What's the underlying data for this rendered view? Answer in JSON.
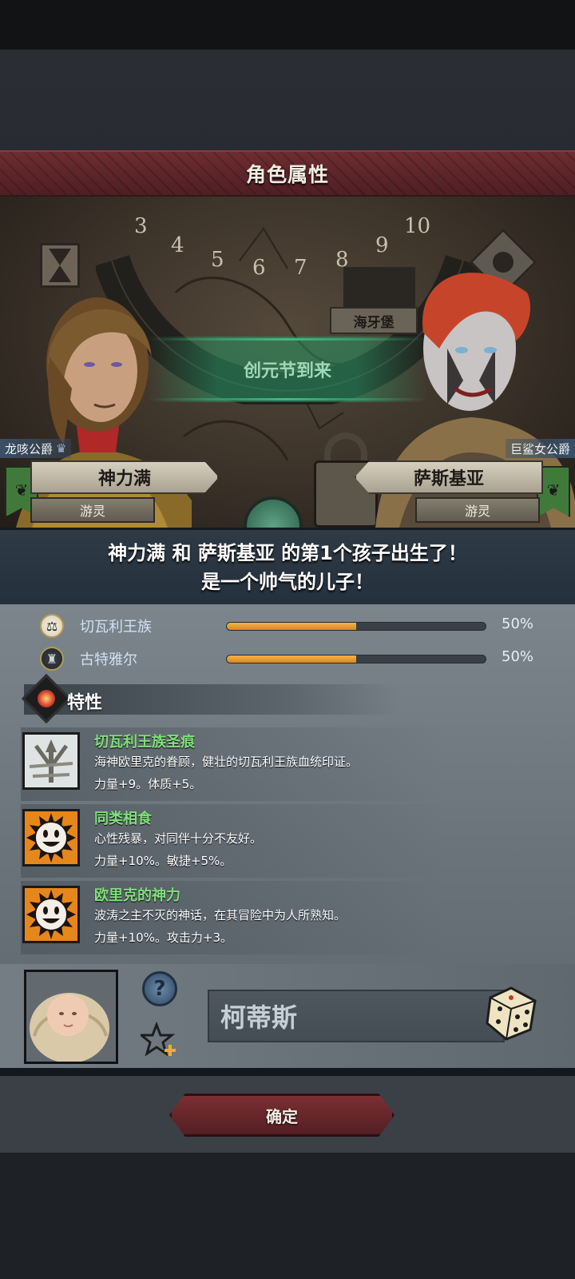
{
  "header": {
    "title": "角色属性"
  },
  "scene": {
    "dial_numbers": [
      "3",
      "4",
      "5",
      "6",
      "7",
      "8",
      "9",
      "10"
    ],
    "location": "海牙堡",
    "event": "创元节到来"
  },
  "parents": {
    "father": {
      "title": "龙咳公爵",
      "name": "神力满",
      "class": "游灵"
    },
    "mother": {
      "title": "巨鲨女公爵",
      "name": "萨斯基亚",
      "class": "游灵"
    }
  },
  "birth_message": {
    "line1": "神力满 和 萨斯基亚 的第1个孩子出生了！",
    "line2": "是一个帅气的儿子！"
  },
  "heritage": [
    {
      "name": "切瓦利王族",
      "percent": 50,
      "percent_label": "50%",
      "icon": "scales-icon"
    },
    {
      "name": "古特雅尔",
      "percent": 50,
      "percent_label": "50%",
      "icon": "clan-icon"
    }
  ],
  "traits_section": {
    "title": "特性"
  },
  "traits": [
    {
      "name": "切瓦利王族圣痕",
      "desc": "海神欧里克的眷顾，健壮的切瓦利王族血统印证。",
      "stats": "力量+9。体质+5。",
      "icon": "trident-icon"
    },
    {
      "name": "同类相食",
      "desc": "心性残暴，对同伴十分不友好。",
      "stats": "力量+10%。敏捷+5%。",
      "icon": "grin-face-icon"
    },
    {
      "name": "欧里克的神力",
      "desc": "波涛之主不灭的神话，在其冒险中为人所熟知。",
      "stats": "力量+10%。攻击力+3。",
      "icon": "grin-face-icon"
    }
  ],
  "child": {
    "name_value": "柯蒂斯",
    "help_label": "?"
  },
  "footer": {
    "confirm_label": "确定"
  },
  "colors": {
    "title_bar": "#6e2c30",
    "trait_name": "#7fe07a",
    "heritage_fill": "#e09a2a",
    "event_green": "#3dbb84"
  }
}
